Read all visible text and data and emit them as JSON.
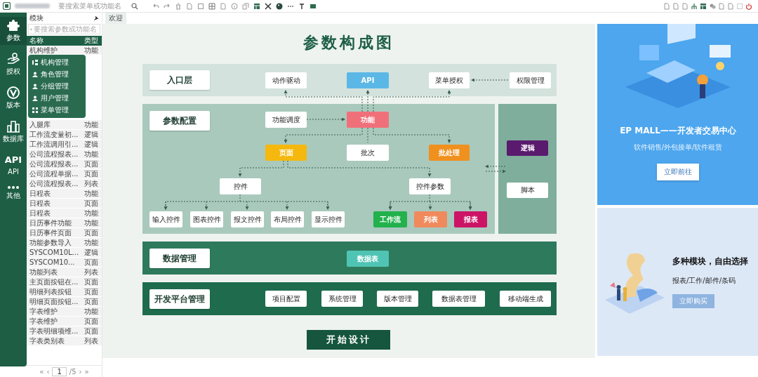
{
  "toolbar": {
    "search": {
      "placeholder": "要搜索菜单或功能名"
    }
  },
  "rail": [
    {
      "kind": "icon",
      "label": "参数",
      "selected": true
    },
    {
      "kind": "icon",
      "label": "授权",
      "selected": false
    },
    {
      "kind": "icon",
      "label": "版本",
      "selected": false
    },
    {
      "kind": "icon",
      "label": "数据库",
      "selected": false
    },
    {
      "kind": "text",
      "icon_text": "API",
      "label": "API",
      "selected": false
    },
    {
      "kind": "icon",
      "label": "其他",
      "selected": false
    }
  ],
  "panel": {
    "title": "模块",
    "search": {
      "placeholder": "要搜索参数或功能名"
    },
    "columns": [
      "名称",
      "类型"
    ],
    "rows": [
      {
        "name": "机构维护",
        "type": "功能"
      },
      {
        "name": "入腿库",
        "type": "功能"
      },
      {
        "name": "工作流变量初...",
        "type": "逻辑"
      },
      {
        "name": "工作流调用引...",
        "type": "逻辑"
      },
      {
        "name": "公司流程报表...",
        "type": "功能"
      },
      {
        "name": "公司流程报表...",
        "type": "页面"
      },
      {
        "name": "公司流程单据...",
        "type": "页面"
      },
      {
        "name": "公司流程报表...",
        "type": "列表"
      },
      {
        "name": "日程表",
        "type": "功能"
      },
      {
        "name": "日程表",
        "type": "页面"
      },
      {
        "name": "日程表",
        "type": "功能"
      },
      {
        "name": "日历事件功能",
        "type": "功能"
      },
      {
        "name": "日历事件页面",
        "type": "页面"
      },
      {
        "name": "功能参数导入",
        "type": "功能"
      },
      {
        "name": "SYSCOM10L...",
        "type": "逻辑"
      },
      {
        "name": "SYSCOM10...",
        "type": "页面"
      },
      {
        "name": "功能列表",
        "type": "列表"
      },
      {
        "name": "主页面按钮在...",
        "type": "页面"
      },
      {
        "name": "明细列表按钮",
        "type": "页面"
      },
      {
        "name": "明细页面按钮...",
        "type": "页面"
      },
      {
        "name": "字表维护",
        "type": "功能"
      },
      {
        "name": "字表维护",
        "type": "页面"
      },
      {
        "name": "字表明细项维...",
        "type": "页面"
      },
      {
        "name": "字表类别表",
        "type": "列表"
      }
    ],
    "pagination": {
      "first": "«",
      "prev": "‹",
      "page": "1",
      "total": "/5",
      "next": "›",
      "last": "»"
    }
  },
  "popup_menu": [
    {
      "label": "机构管理"
    },
    {
      "label": "角色管理"
    },
    {
      "label": "分组管理"
    },
    {
      "label": "用户管理"
    },
    {
      "label": "菜单管理"
    }
  ],
  "tabs": [
    {
      "label": "欢迎",
      "selected": true
    }
  ],
  "diagram": {
    "title": "参数构成图",
    "layers": [
      "入口层",
      "参数配置",
      "数据管理",
      "开发平台管理"
    ],
    "nodes": [
      {
        "label": "动作驱动",
        "kind": "plain",
        "color": "#ffffff"
      },
      {
        "label": "API",
        "kind": "filled",
        "color": "#5bb8e6"
      },
      {
        "label": "菜单授权",
        "kind": "plain",
        "color": "#ffffff"
      },
      {
        "label": "权限管理",
        "kind": "plain",
        "color": "#ffffff"
      },
      {
        "label": "功能调度",
        "kind": "plain",
        "color": "#ffffff"
      },
      {
        "label": "功能",
        "kind": "filled",
        "color": "#f0707a"
      },
      {
        "label": "页面",
        "kind": "filled",
        "color": "#f5b80f"
      },
      {
        "label": "批次",
        "kind": "plain",
        "color": "#ffffff"
      },
      {
        "label": "批处理",
        "kind": "filled",
        "color": "#f0901e"
      },
      {
        "label": "逻辑",
        "kind": "filled",
        "color": "#5a1a6e"
      },
      {
        "label": "脚本",
        "kind": "plain",
        "color": "#ffffff"
      },
      {
        "label": "控件",
        "kind": "plain",
        "color": "#ffffff"
      },
      {
        "label": "控件参数",
        "kind": "plain",
        "color": "#ffffff"
      },
      {
        "label": "输入控件",
        "kind": "plain",
        "color": "#ffffff"
      },
      {
        "label": "图表控件",
        "kind": "plain",
        "color": "#ffffff"
      },
      {
        "label": "报文控件",
        "kind": "plain",
        "color": "#ffffff"
      },
      {
        "label": "布局控件",
        "kind": "plain",
        "color": "#ffffff"
      },
      {
        "label": "显示控件",
        "kind": "plain",
        "color": "#ffffff"
      },
      {
        "label": "工作流",
        "kind": "filled",
        "color": "#22b14c"
      },
      {
        "label": "列表",
        "kind": "filled",
        "color": "#f08a5d"
      },
      {
        "label": "报表",
        "kind": "filled",
        "color": "#cc1466"
      },
      {
        "label": "数据表",
        "kind": "filled",
        "color": "#4fc4b4"
      },
      {
        "label": "项目配置",
        "kind": "plain",
        "color": "#ffffff"
      },
      {
        "label": "系统管理",
        "kind": "plain",
        "color": "#ffffff"
      },
      {
        "label": "版本管理",
        "kind": "plain",
        "color": "#ffffff"
      },
      {
        "label": "数据表管理",
        "kind": "plain",
        "color": "#ffffff"
      },
      {
        "label": "移动端生成",
        "kind": "plain",
        "color": "#ffffff"
      }
    ],
    "start_button": "开始设计"
  },
  "ads": [
    {
      "title": "EP MALL——开发者交易中心",
      "subtitle": "软件销售/外包接单/软件租赁",
      "button": "立即前往"
    },
    {
      "title": "多种模块，自由选择",
      "subtitle": "报表/工作/邮件/条码",
      "button": "立即购买"
    }
  ]
}
